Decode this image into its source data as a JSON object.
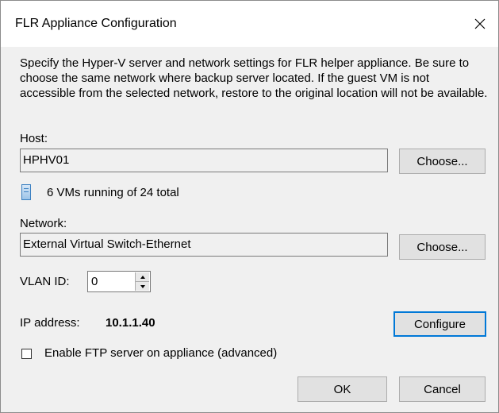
{
  "window": {
    "title": "FLR Appliance Configuration",
    "close_icon": "close-icon"
  },
  "description": "Specify the Hyper-V server and network settings for FLR helper appliance. Be sure to choose the same network where backup server located. If the guest VM is not accessible from the selected network, restore to the original location will not be available.",
  "host": {
    "label": "Host:",
    "value": "HPHV01",
    "choose_label": "Choose..."
  },
  "vm_status": {
    "icon": "server-icon",
    "text": "6 VMs running of 24 total"
  },
  "network": {
    "label": "Network:",
    "value": "External Virtual Switch-Ethernet",
    "choose_label": "Choose..."
  },
  "vlan": {
    "label": "VLAN ID:",
    "value": "0"
  },
  "ip": {
    "label": "IP address:",
    "value": "10.1.1.40",
    "configure_label": "Configure"
  },
  "ftp": {
    "label": "Enable FTP server on appliance (advanced)",
    "checked": false
  },
  "footer": {
    "ok_label": "OK",
    "cancel_label": "Cancel"
  },
  "colors": {
    "dialog_bg": "#f0f0f0",
    "titlebar_bg": "#ffffff",
    "focus_border": "#0078d7"
  }
}
